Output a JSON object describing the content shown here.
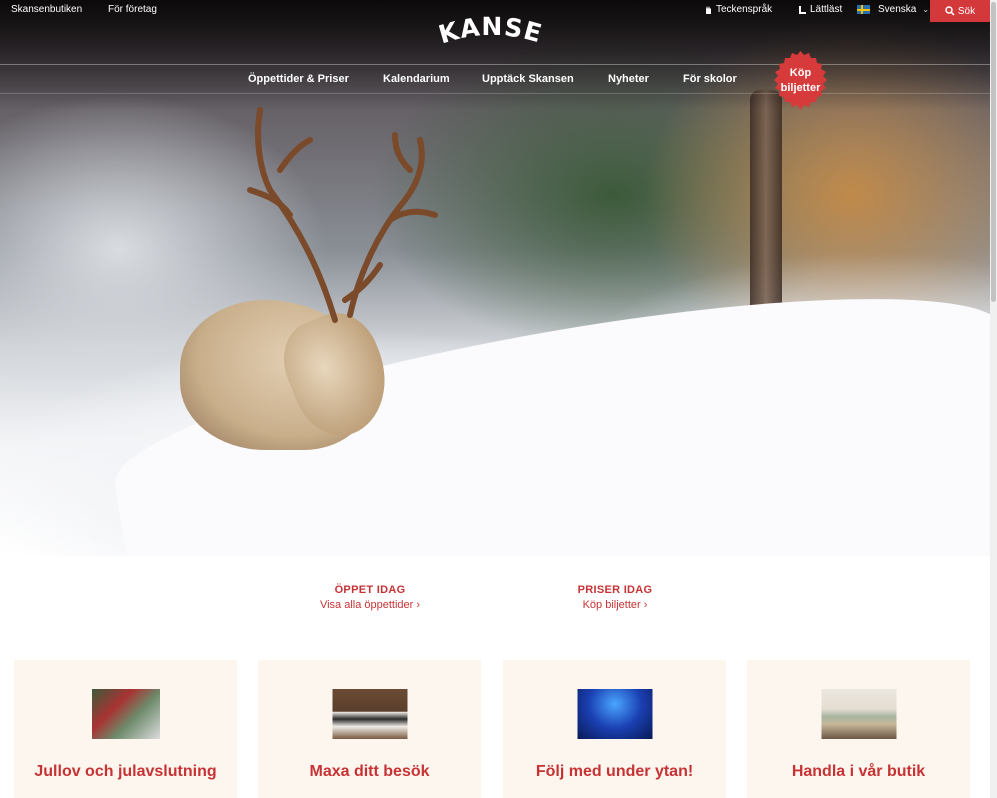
{
  "top_links": {
    "shop": "Skansenbutiken",
    "business": "För företag"
  },
  "utility": {
    "sign_language": "Teckenspråk",
    "easy_read": "Lättläst",
    "language": "Svenska",
    "search": "Sök"
  },
  "logo": {
    "text": "SKANSEN"
  },
  "nav": {
    "items": [
      "Öppettider & Priser",
      "Kalendarium",
      "Upptäck Skansen",
      "Nyheter",
      "För skolor"
    ],
    "buy_line1": "Köp",
    "buy_line2": "biljetter"
  },
  "info": {
    "open": {
      "title": "ÖPPET IDAG",
      "link": "Visa alla öppettider ›"
    },
    "prices": {
      "title": "PRISER IDAG",
      "link": "Köp biljetter ›"
    }
  },
  "cards": [
    {
      "title": "Jullov och julavslutning"
    },
    {
      "title": "Maxa ditt besök"
    },
    {
      "title": "Följ med under ytan!"
    },
    {
      "title": "Handla i vår butik"
    }
  ],
  "colors": {
    "accent": "#d3383a",
    "card_bg": "#fdf6ee",
    "badge": "#d63a3a"
  },
  "icons": [
    "hand-sign-icon",
    "easy-read-icon",
    "swedish-flag-icon",
    "chevron-down-icon",
    "search-icon"
  ]
}
